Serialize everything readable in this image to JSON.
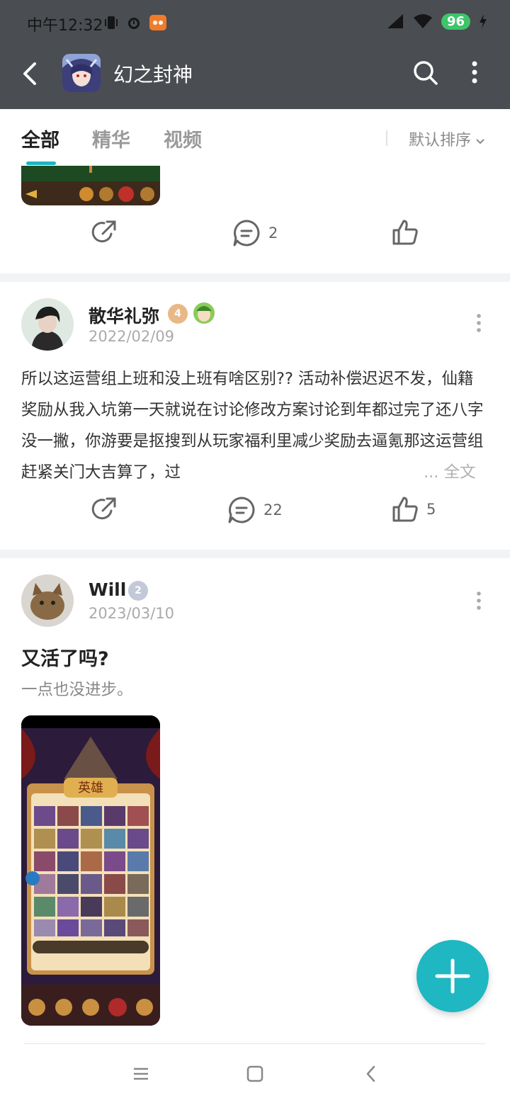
{
  "status_bar": {
    "time": "中午12:32",
    "battery": "96"
  },
  "header": {
    "title": "幻之封神"
  },
  "tabs": {
    "items": [
      {
        "label": "全部"
      },
      {
        "label": "精华"
      },
      {
        "label": "视频"
      }
    ],
    "active_index": 0,
    "sort_label": "默认排序"
  },
  "posts": [
    {
      "comment_count": "2",
      "like_count": ""
    },
    {
      "user": "散华礼弥",
      "level": "4",
      "date": "2022/02/09",
      "body": "所以这运营组上班和没上班有啥区别?? 活动补偿迟迟不发，仙籍奖励从我入坑第一天就说在讨论修改方案讨论到年都过完了还八字没一撇，你游要是抠搜到从玩家福利里减少奖励去逼氪那这运营组赶紧关门大吉算了，过",
      "more_label": "... 全文",
      "comment_count": "22",
      "like_count": "5"
    },
    {
      "user": "Will",
      "level": "2",
      "date": "2023/03/10",
      "title": "又活了吗?",
      "subtitle": "一点也没进步。"
    }
  ],
  "game_image_title": "英雄",
  "colors": {
    "accent": "#1fb7c1",
    "header_bg": "#4a4d51"
  },
  "icons": [
    "back-icon",
    "search-icon",
    "more-icon",
    "share-icon",
    "comment-icon",
    "like-icon",
    "add-icon",
    "nav-menu-icon",
    "nav-home-icon",
    "nav-back-icon"
  ]
}
